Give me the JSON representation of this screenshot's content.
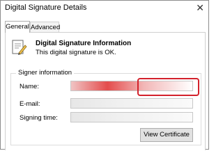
{
  "window": {
    "title": "Digital Signature Details",
    "close_glyph": "✕"
  },
  "tabs": [
    {
      "label": "General"
    },
    {
      "label": "Advanced"
    }
  ],
  "info": {
    "title": "Digital Signature Information",
    "status": "This digital signature is OK.",
    "icon": "certificate-icon"
  },
  "signer": {
    "group_label": "Signer information",
    "name_label": "Name:",
    "email_label": "E-mail:",
    "time_label": "Signing time:"
  },
  "buttons": {
    "view_certificate": "View Certificate"
  },
  "colors": {
    "highlight": "#d3212b"
  }
}
